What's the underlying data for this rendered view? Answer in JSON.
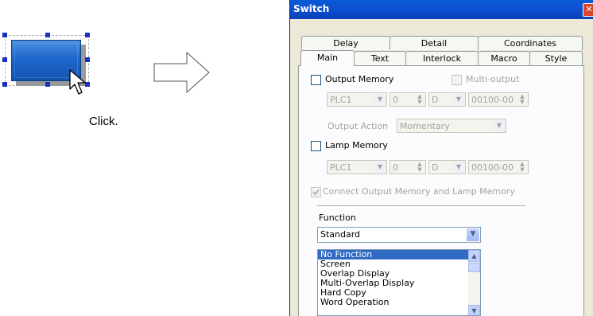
{
  "illustration": {
    "click_label": "Click."
  },
  "dialog": {
    "title": "Switch",
    "close_icon": "close-icon",
    "tabs_back": [
      "Delay",
      "Detail",
      "Coordinates"
    ],
    "tabs_front": [
      "Main",
      "Text",
      "Interlock",
      "Macro",
      "Style"
    ],
    "active_tab": "Main",
    "output_memory": {
      "label": "Output Memory",
      "checked": false,
      "multi_output_label": "Multi-output",
      "plc": "PLC1",
      "station": "0",
      "device": "D",
      "address": "00100-00"
    },
    "output_action": {
      "label": "Output Action",
      "value": "Momentary"
    },
    "lamp_memory": {
      "label": "Lamp Memory",
      "checked": false,
      "plc": "PLC1",
      "station": "0",
      "device": "D",
      "address": "00100-00"
    },
    "connect_label": "Connect Output Memory and Lamp Memory",
    "function": {
      "label": "Function",
      "selected": "Standard",
      "list": [
        "No Function",
        "Screen",
        "Overlap Display",
        "Multi-Overlap Display",
        "Hard Copy",
        "Word Operation"
      ],
      "list_selected_index": 0
    }
  }
}
